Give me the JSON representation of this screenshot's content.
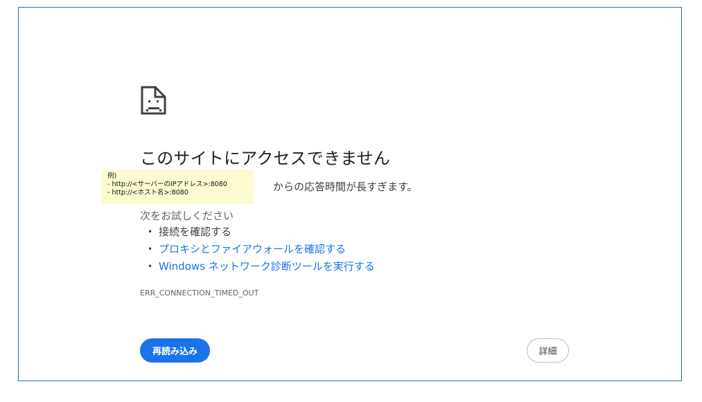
{
  "colors": {
    "frame_border": "#2e6c9c",
    "link": "#1a73e8",
    "primary_button": "#1a73e8",
    "tooltip_bg": "#fbfbcf",
    "text": "#202124"
  },
  "icon": "sad-document-icon",
  "title": "このサイトにアクセスできません",
  "description": {
    "hidden_host": "",
    "text": "からの応答時間が長すぎます。"
  },
  "try_heading": "次をお試しください",
  "suggestions": [
    {
      "text": "接続を確認する",
      "is_link": false
    },
    {
      "text": "プロキシとファイアウォールを確認する",
      "is_link": true
    },
    {
      "text": "Windows ネットワーク診断ツールを実行する",
      "is_link": true
    }
  ],
  "bullet": "•",
  "error_code": "ERR_CONNECTION_TIMED_OUT",
  "buttons": {
    "reload": "再読み込み",
    "details": "詳細"
  },
  "tooltip": {
    "lines": [
      "例)",
      "- http://<サーバーのIPアドレス>:8080",
      "- http://<ホスト名>:8080"
    ]
  }
}
